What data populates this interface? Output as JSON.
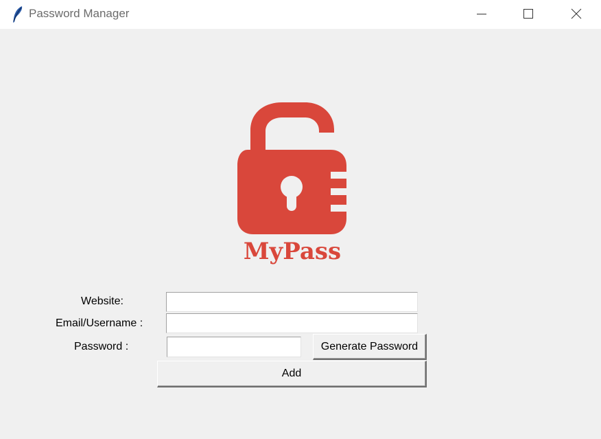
{
  "window": {
    "title": "Password Manager",
    "icon": "feather-icon"
  },
  "logo": {
    "text": "MyPass",
    "icon": "open-padlock-icon",
    "color": "#d9473b"
  },
  "form": {
    "website_label": "Website:",
    "website_value": "",
    "email_label": "Email/Username :",
    "email_value": "",
    "password_label": "Password :",
    "password_value": "",
    "generate_label": "Generate Password",
    "add_label": "Add"
  }
}
